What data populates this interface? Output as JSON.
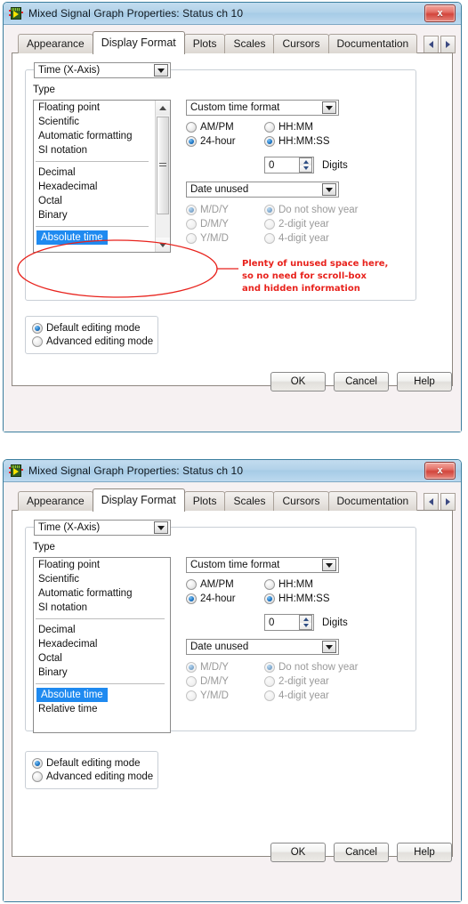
{
  "window": {
    "title": "Mixed Signal Graph Properties: Status ch 10",
    "close_label": "x",
    "icon": "labview-graph-icon"
  },
  "tabs": [
    {
      "label": "Appearance",
      "active": false
    },
    {
      "label": "Display Format",
      "active": true
    },
    {
      "label": "Plots",
      "active": false
    },
    {
      "label": "Scales",
      "active": false
    },
    {
      "label": "Cursors",
      "active": false
    },
    {
      "label": "Documentation",
      "active": false
    }
  ],
  "tab_nav": {
    "prev": "◄",
    "next": "►"
  },
  "axis_selector": {
    "value": "Time (X-Axis)"
  },
  "type_section": {
    "label": "Type",
    "items": [
      {
        "label": "Floating point",
        "selected": false,
        "separator_after": false
      },
      {
        "label": "Scientific",
        "selected": false,
        "separator_after": false
      },
      {
        "label": "Automatic formatting",
        "selected": false,
        "separator_after": false
      },
      {
        "label": "SI notation",
        "selected": false,
        "separator_after": true
      },
      {
        "label": "Decimal",
        "selected": false,
        "separator_after": false
      },
      {
        "label": "Hexadecimal",
        "selected": false,
        "separator_after": false
      },
      {
        "label": "Octal",
        "selected": false,
        "separator_after": false
      },
      {
        "label": "Binary",
        "selected": false,
        "separator_after": true
      },
      {
        "label": "Absolute time",
        "selected": true,
        "separator_after": false
      },
      {
        "label": "Relative time",
        "selected": false,
        "separator_after": false
      }
    ]
  },
  "time_format": {
    "combo_value": "Custom time format",
    "clock_options": [
      {
        "label": "AM/PM",
        "selected": false,
        "disabled": false
      },
      {
        "label": "24-hour",
        "selected": true,
        "disabled": false
      }
    ],
    "precision_options": [
      {
        "label": "HH:MM",
        "selected": false,
        "disabled": false
      },
      {
        "label": "HH:MM:SS",
        "selected": true,
        "disabled": false
      }
    ],
    "digits": {
      "value": "0",
      "label": "Digits"
    }
  },
  "date_format": {
    "combo_value": "Date unused",
    "order_options": [
      {
        "label": "M/D/Y",
        "selected": true,
        "disabled": true
      },
      {
        "label": "D/M/Y",
        "selected": false,
        "disabled": true
      },
      {
        "label": "Y/M/D",
        "selected": false,
        "disabled": true
      }
    ],
    "year_options": [
      {
        "label": "Do not show year",
        "selected": true,
        "disabled": true
      },
      {
        "label": "2-digit year",
        "selected": false,
        "disabled": true
      },
      {
        "label": "4-digit year",
        "selected": false,
        "disabled": true
      }
    ]
  },
  "editing_mode": {
    "options": [
      {
        "label": "Default editing mode",
        "selected": true
      },
      {
        "label": "Advanced editing mode",
        "selected": false
      }
    ]
  },
  "footer": {
    "ok": "OK",
    "cancel": "Cancel",
    "help": "Help"
  },
  "annotation": {
    "color": "#e8221c",
    "line1": "Plenty of unused space here,",
    "line2": "so no need for scroll-box",
    "line3": "and hidden information"
  }
}
